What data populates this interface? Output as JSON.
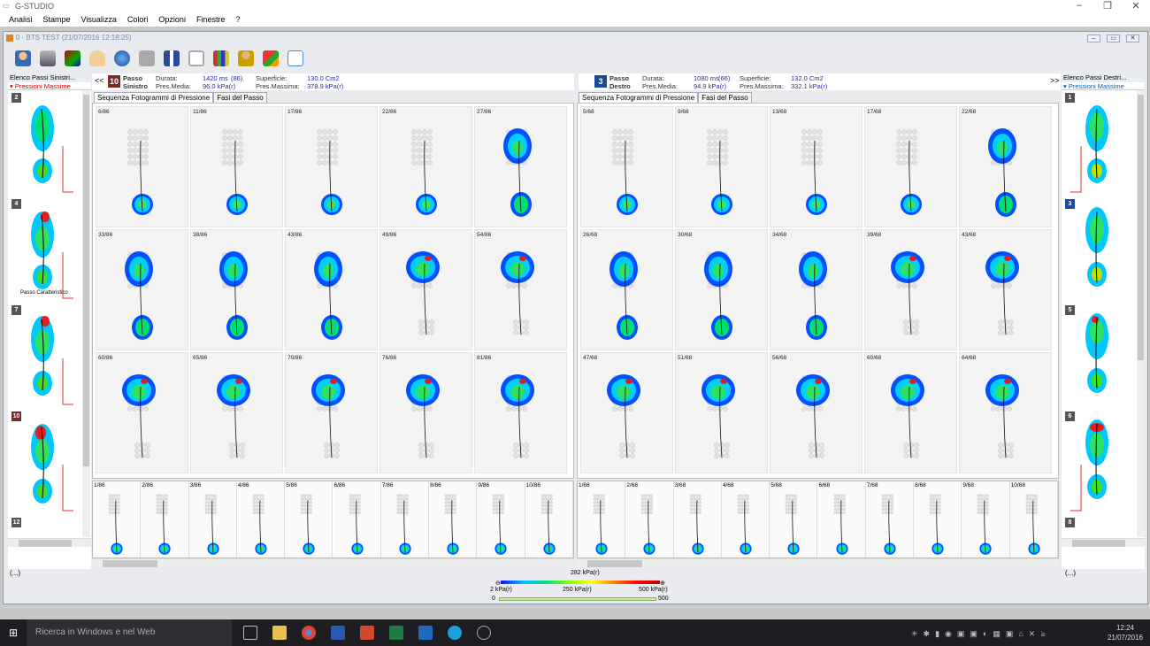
{
  "app": {
    "title": "G-STUDIO"
  },
  "menu": [
    "Analisi",
    "Stampe",
    "Visualizza",
    "Colori",
    "Opzioni",
    "Finestre",
    "?"
  ],
  "child_window": {
    "title": "0 - BTS TEST  (21/07/2016 12:18:25)"
  },
  "left_panel": {
    "header": "Elenco Passi Sinistri...",
    "subheader": "Pressioni Massime",
    "items": [
      {
        "num": "2"
      },
      {
        "num": "4",
        "caption": "Passo Caratteristico"
      },
      {
        "num": "7"
      },
      {
        "num": "10"
      },
      {
        "num": "12"
      }
    ]
  },
  "right_panel": {
    "header": "Elenco Passi Destri...",
    "subheader": "Pressioni Massime",
    "items": [
      {
        "num": "1"
      },
      {
        "num": "3"
      },
      {
        "num": "5"
      },
      {
        "num": "6"
      },
      {
        "num": "8"
      }
    ]
  },
  "left_step": {
    "nav": "<<",
    "number": "10",
    "side1": "Passo",
    "side2": "Sinistro",
    "durata_label": "Durata:",
    "durata": "1420 ms",
    "durata_n": "(86)",
    "presmedia_label": "Pres.Media:",
    "presmedia": "96.0 kPa(r)",
    "superficie_label": "Superficie:",
    "superficie": "130.0 Cm2",
    "presmax_label": "Pres.Massima:",
    "presmax": "378.9 kPa(r)"
  },
  "right_step": {
    "nav": ">>",
    "number": "3",
    "side1": "Passo",
    "side2": "Destro",
    "durata_label": "Durata:",
    "durata": "1080 ms",
    "durata_n": "(66)",
    "presmedia_label": "Pres.Media:",
    "presmedia": "94.9 kPa(r)",
    "superficie_label": "Superficie:",
    "superficie": "132.0 Cm2",
    "presmax_label": "Pres.Massima:",
    "presmax": "332.1 kPa(r)"
  },
  "tabs": {
    "sequence": "Sequenza Fotogrammi di Pressione",
    "phases": "Fasi del Passo"
  },
  "left_frames": [
    "6/86",
    "11/86",
    "17/86",
    "22/86",
    "27/86",
    "33/86",
    "38/86",
    "43/86",
    "49/86",
    "54/86",
    "60/86",
    "65/86",
    "70/86",
    "76/86",
    "81/86"
  ],
  "right_frames": [
    "5/68",
    "9/68",
    "13/68",
    "17/68",
    "22/68",
    "26/68",
    "30/68",
    "34/68",
    "39/68",
    "43/68",
    "47/68",
    "51/68",
    "56/68",
    "60/68",
    "64/68"
  ],
  "left_strip": [
    "1/86",
    "2/86",
    "3/86",
    "4/86",
    "5/86",
    "6/86",
    "7/86",
    "8/86",
    "9/86",
    "10/86"
  ],
  "right_strip": [
    "1/68",
    "2/68",
    "3/68",
    "4/68",
    "5/68",
    "6/68",
    "7/68",
    "8/68",
    "9/68",
    "10/68"
  ],
  "status": {
    "left": "(...)",
    "right": "(...)"
  },
  "legend": {
    "current": "282 kPa(r)",
    "min": "2 kPa(r)",
    "mid": "250 kPa(r)",
    "max": "500 kPa(r)",
    "slider_min": "0",
    "slider_max": "500"
  },
  "taskbar": {
    "search": "Ricerca in Windows e nel Web",
    "time": "12:24",
    "date": "21/07/2016"
  },
  "colors": {
    "accent_left": "#7a2a2a",
    "accent_right": "#1a4a9a"
  }
}
